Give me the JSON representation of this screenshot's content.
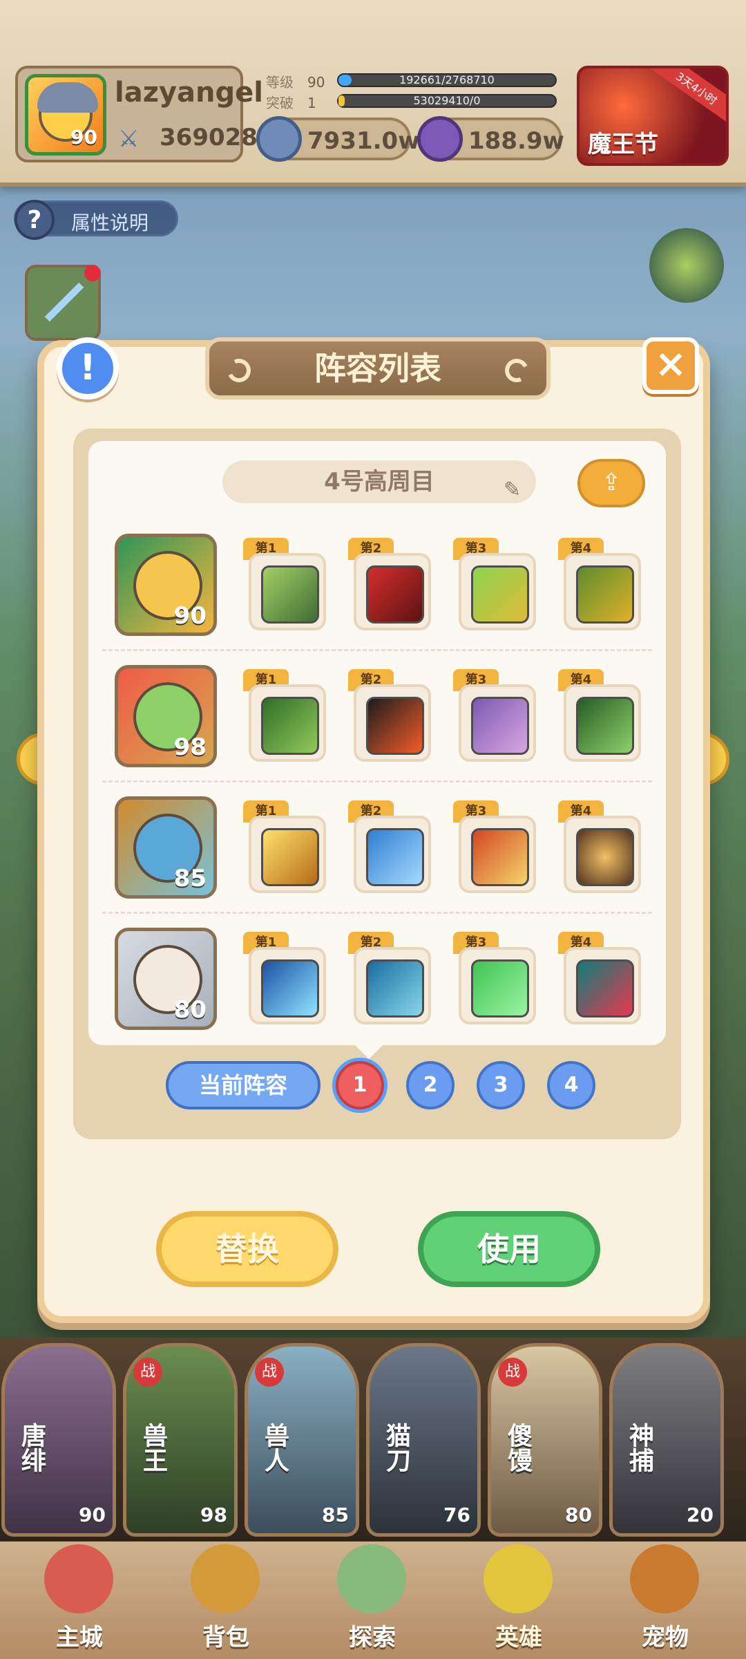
{
  "player": {
    "name": "lazyangel",
    "avatar_level": "90",
    "power": "369028",
    "level_label": "等级",
    "level_value": "90",
    "exp_progress": "192661/2768710",
    "breakthrough_label": "突破",
    "breakthrough_value": "1",
    "break_progress": "53029410/0",
    "currency_1": "7931.0w",
    "currency_2": "188.9w"
  },
  "event": {
    "ribbon": "3天4小时",
    "label": "魔王节"
  },
  "attributes_button": "属性说明",
  "dialog": {
    "title": "阵容列表",
    "team_name": "4号高周目",
    "current_label": "当前阵容",
    "slots": [
      "1",
      "2",
      "3",
      "4"
    ],
    "replace_label": "替换",
    "use_label": "使用"
  },
  "heroes": [
    {
      "level": "90",
      "skills": [
        {
          "tag": "第1"
        },
        {
          "tag": "第2"
        },
        {
          "tag": "第3"
        },
        {
          "tag": "第4"
        }
      ]
    },
    {
      "level": "98",
      "skills": [
        {
          "tag": "第1"
        },
        {
          "tag": "第2"
        },
        {
          "tag": "第3"
        },
        {
          "tag": "第4"
        }
      ]
    },
    {
      "level": "85",
      "skills": [
        {
          "tag": "第1"
        },
        {
          "tag": "第2"
        },
        {
          "tag": "第3"
        },
        {
          "tag": "第4"
        }
      ]
    },
    {
      "level": "80",
      "skills": [
        {
          "tag": "第1"
        },
        {
          "tag": "第2"
        },
        {
          "tag": "第3"
        },
        {
          "tag": "第4"
        }
      ]
    }
  ],
  "hero_strip": [
    {
      "name": "唐绯",
      "level": "90",
      "war": ""
    },
    {
      "name": "兽王",
      "level": "98",
      "war": "战"
    },
    {
      "name": "兽人",
      "level": "85",
      "war": "战"
    },
    {
      "name": "猫刀",
      "level": "76",
      "war": ""
    },
    {
      "name": "傻馒",
      "level": "80",
      "war": "战"
    },
    {
      "name": "神捕",
      "level": "20",
      "war": ""
    }
  ],
  "tabs": [
    "主城",
    "背包",
    "探索",
    "英雄",
    "宠物"
  ]
}
